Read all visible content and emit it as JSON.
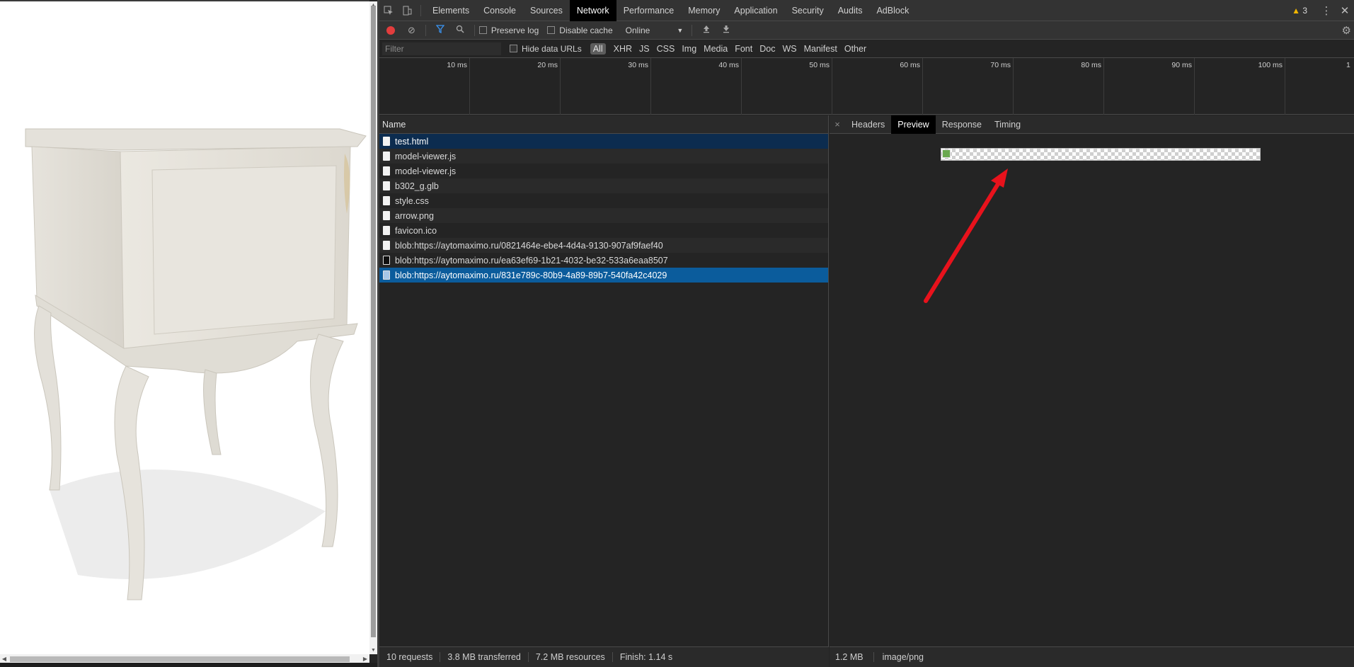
{
  "devtools": {
    "tabs": [
      "Elements",
      "Console",
      "Sources",
      "Network",
      "Performance",
      "Memory",
      "Application",
      "Security",
      "Audits",
      "AdBlock"
    ],
    "active_tab": "Network",
    "warning_count": "3"
  },
  "toolbar": {
    "preserve_log": "Preserve log",
    "disable_cache": "Disable cache",
    "throttle": "Online"
  },
  "filterbar": {
    "placeholder": "Filter",
    "hide_data_urls": "Hide data URLs",
    "types": [
      "All",
      "XHR",
      "JS",
      "CSS",
      "Img",
      "Media",
      "Font",
      "Doc",
      "WS",
      "Manifest",
      "Other"
    ]
  },
  "timeline": {
    "ticks": [
      "10 ms",
      "20 ms",
      "30 ms",
      "40 ms",
      "50 ms",
      "60 ms",
      "70 ms",
      "80 ms",
      "90 ms",
      "100 ms",
      "1"
    ]
  },
  "list": {
    "header": "Name",
    "requests": [
      {
        "name": "test.html",
        "icon": "document-icon",
        "state": "selected-dark"
      },
      {
        "name": "model-viewer.js",
        "icon": "document-icon",
        "state": ""
      },
      {
        "name": "model-viewer.js",
        "icon": "document-icon",
        "state": ""
      },
      {
        "name": "b302_g.glb",
        "icon": "document-icon",
        "state": ""
      },
      {
        "name": "style.css",
        "icon": "document-icon",
        "state": ""
      },
      {
        "name": "arrow.png",
        "icon": "document-icon",
        "state": ""
      },
      {
        "name": "favicon.ico",
        "icon": "document-icon",
        "state": ""
      },
      {
        "name": "blob:https://aytomaximo.ru/0821464e-ebe4-4d4a-9130-907af9faef40",
        "icon": "document-icon",
        "state": ""
      },
      {
        "name": "blob:https://aytomaximo.ru/ea63ef69-1b21-4032-be32-533a6eaa8507",
        "icon": "dark-file-icon",
        "state": ""
      },
      {
        "name": "blob:https://aytomaximo.ru/831e789c-80b9-4a89-89b7-540fa42c4029",
        "icon": "image-file-icon",
        "state": "selected"
      }
    ]
  },
  "preview": {
    "close": "×",
    "tabs": [
      "Headers",
      "Preview",
      "Response",
      "Timing"
    ],
    "active_tab": "Preview"
  },
  "status": {
    "requests": "10 requests",
    "transferred": "3.8 MB transferred",
    "resources": "7.2 MB resources",
    "finish": "Finish: 1.14 s"
  },
  "preview_status": {
    "size": "1.2 MB",
    "mime": "image/png"
  },
  "colors": {
    "record": "#e33d3d",
    "selection": "#0b5c9c",
    "arrow": "#e8121c",
    "warning": "#f2b600"
  }
}
